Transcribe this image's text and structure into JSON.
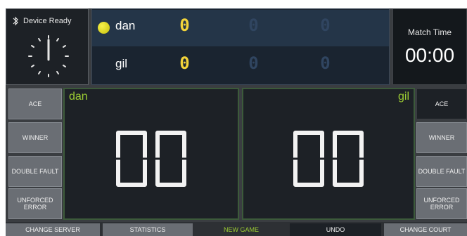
{
  "status": {
    "bluetooth_icon": "bluetooth-icon",
    "device_label": "Device Ready",
    "clock_icon": "clock-icon"
  },
  "players": [
    {
      "name": "dan",
      "serving": true,
      "sets": [
        "0",
        "0",
        "0"
      ],
      "points": "00"
    },
    {
      "name": "gil",
      "serving": false,
      "sets": [
        "0",
        "0",
        "0"
      ],
      "points": "00"
    }
  ],
  "match_time": {
    "label": "Match Time",
    "value": "00:00"
  },
  "left_buttons": [
    {
      "label": "ACE"
    },
    {
      "label": "WINNER"
    },
    {
      "label": "DOUBLE FAULT"
    },
    {
      "label": "UNFORCED ERROR"
    }
  ],
  "right_buttons": [
    {
      "label": "ACE"
    },
    {
      "label": "WINNER"
    },
    {
      "label": "DOUBLE FAULT"
    },
    {
      "label": "UNFORCED ERROR"
    }
  ],
  "bottom_bar": [
    {
      "label": "CHANGE SERVER"
    },
    {
      "label": "STATISTICS"
    },
    {
      "label": "NEW GAME"
    },
    {
      "label": "UNDO"
    },
    {
      "label": "CHANGE COURT"
    }
  ],
  "colors": {
    "accent_green": "#9ccc33",
    "set_yellow": "#f2d33a",
    "ball_yellow": "#e5df1f"
  }
}
